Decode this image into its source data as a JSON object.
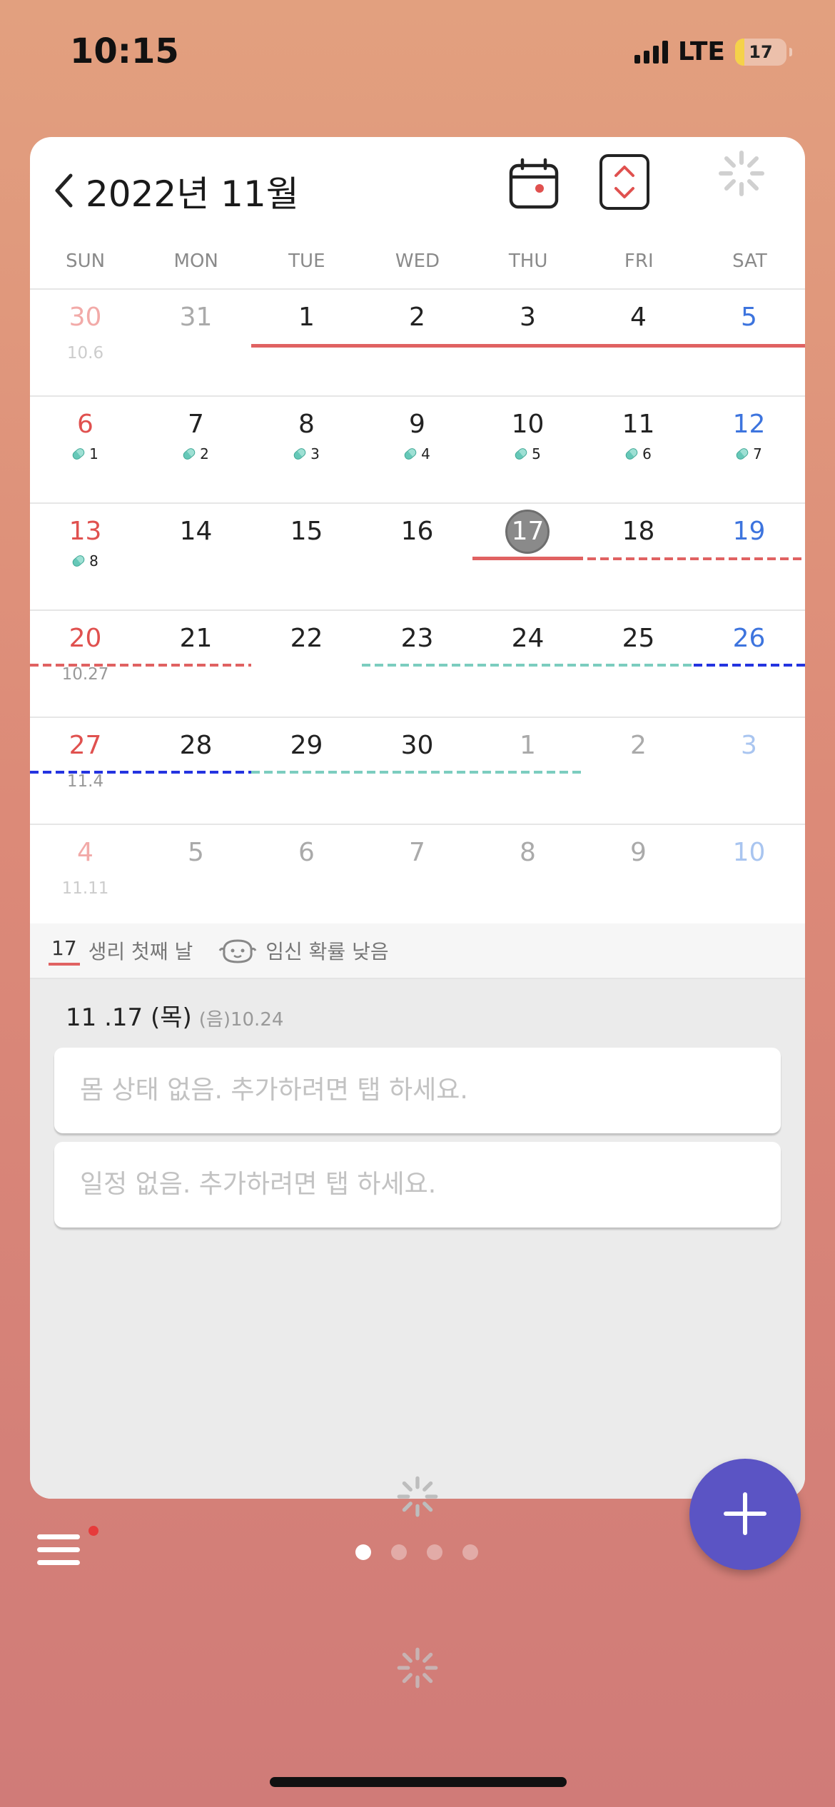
{
  "status": {
    "time": "10:15",
    "network": "LTE",
    "battery": "17"
  },
  "header": {
    "title": "2022년 11월",
    "back_icon": "chevron-left-icon",
    "calendar_icon": "calendar-icon",
    "toggle_icon": "expand-collapse-icon"
  },
  "weekdays": [
    "SUN",
    "MON",
    "TUE",
    "WED",
    "THU",
    "FRI",
    "SAT"
  ],
  "calendar": {
    "w1": [
      "30",
      "31",
      "1",
      "2",
      "3",
      "4",
      "5"
    ],
    "w1_sub_sun": "10.6",
    "w2": [
      "6",
      "7",
      "8",
      "9",
      "10",
      "11",
      "12"
    ],
    "w2_pills": [
      "1",
      "2",
      "3",
      "4",
      "5",
      "6",
      "7"
    ],
    "w3": [
      "13",
      "14",
      "15",
      "16",
      "17",
      "18",
      "19"
    ],
    "w3_pill_sun": "8",
    "w4": [
      "20",
      "21",
      "22",
      "23",
      "24",
      "25",
      "26"
    ],
    "w4_sub_sun": "10.27",
    "w5": [
      "27",
      "28",
      "29",
      "30",
      "1",
      "2",
      "3"
    ],
    "w5_sub_sun": "11.4",
    "w6": [
      "4",
      "5",
      "6",
      "7",
      "8",
      "9",
      "10"
    ],
    "w6_sub_sun": "11.11",
    "today": "17"
  },
  "info": {
    "day_count": "17",
    "phase": "생리 첫째 날",
    "pregnancy": "임신 확률 낮음"
  },
  "detail": {
    "date": "11 .17 (목)",
    "lunar": "(음)10.24",
    "condition_placeholder": "몸 상태 없음. 추가하려면 탭 하세요.",
    "schedule_placeholder": "일정 없음. 추가하려면 탭 하세요."
  },
  "pager": {
    "pages": 4,
    "active": 1
  },
  "colors": {
    "accent": "#5b54c4",
    "period": "#e06262",
    "fertile": "#7ccdbf",
    "ovulation": "#2434e0"
  }
}
